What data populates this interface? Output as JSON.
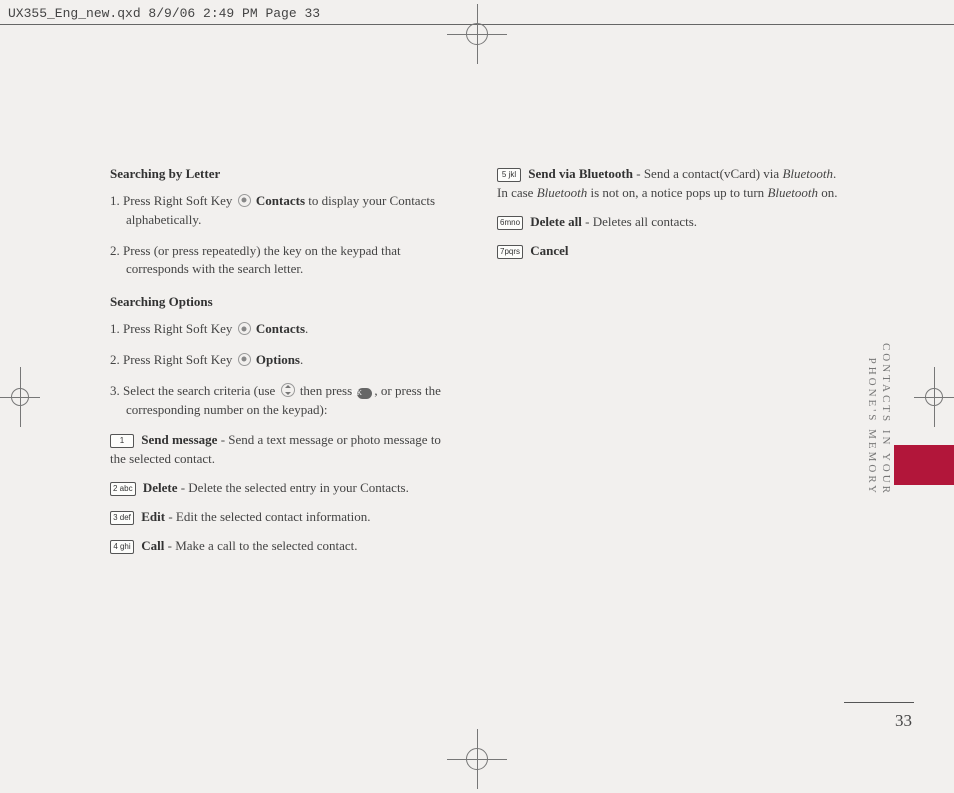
{
  "slug": "UX355_Eng_new.qxd  8/9/06  2:49 PM  Page 33",
  "page_number": "33",
  "running_head_line1": "CONTACTS IN YOUR",
  "running_head_line2": "PHONE'S MEMORY",
  "left": {
    "heading1": "Searching by Letter",
    "step1_prefix": "1. Press Right Soft Key ",
    "step1_bold": "Contacts",
    "step1_suffix": " to display your Contacts alphabetically.",
    "step2": "2. Press (or press repeatedly) the key on the keypad that corresponds with the search letter.",
    "heading2": "Searching Options",
    "opt_step1_prefix": "1. Press Right Soft Key ",
    "opt_step1_bold": "Contacts",
    "opt_step1_suffix": ".",
    "opt_step2_prefix": "2. Press Right Soft Key ",
    "opt_step2_bold": "Options",
    "opt_step2_suffix": ".",
    "opt_step3_prefix": "3. Select the search criteria (use ",
    "opt_step3_mid": " then press ",
    "opt_step3_suffix": ", or press the corresponding number on the keypad):",
    "item1_key": "1",
    "item1_bold": "Send message",
    "item1_text": " - Send a text message or photo message to the selected contact.",
    "item2_key": "2 abc",
    "item2_bold": "Delete",
    "item2_text": " - Delete the selected entry in your Contacts.",
    "item3_key": "3 def",
    "item3_bold": "Edit",
    "item3_text": " - Edit the selected contact information.",
    "item4_key": "4 ghi",
    "item4_bold": "Call",
    "item4_text": " - Make a call to the selected contact."
  },
  "right": {
    "item5_key": "5 jkl",
    "item5_bold": "Send via Bluetooth",
    "item5_text_a": " - Send a contact(vCard) via ",
    "item5_italic1": "Bluetooth",
    "item5_text_b": ". In case ",
    "item5_italic2": "Bluetooth",
    "item5_text_c": " is not on, a notice pops up to turn ",
    "item5_italic3": "Bluetooth",
    "item5_text_d": " on.",
    "item6_key": "6mno",
    "item6_bold": "Delete all",
    "item6_text": " - Deletes all contacts.",
    "item7_key": "7pqrs",
    "item7_bold": "Cancel"
  },
  "ok_label": "OK"
}
